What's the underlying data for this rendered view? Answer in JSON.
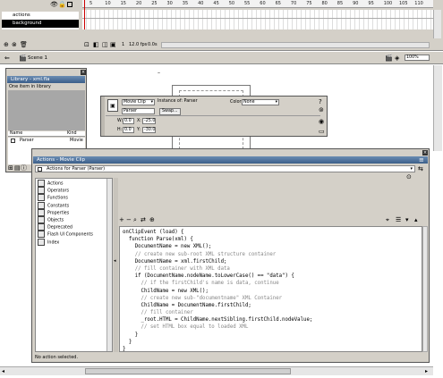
{
  "timeline": {
    "layers": [
      {
        "name": "actions"
      },
      {
        "name": "background"
      }
    ],
    "ruler_ticks": [
      "5",
      "10",
      "15",
      "20",
      "25",
      "30",
      "35",
      "40",
      "45",
      "50",
      "55",
      "60",
      "65",
      "70",
      "75",
      "80",
      "85",
      "90",
      "95",
      "100",
      "105",
      "110"
    ],
    "status": {
      "frame": "1",
      "fps": "12.0 fps",
      "elapsed": "0.0s"
    }
  },
  "edit_bar": {
    "scene": "Scene 1",
    "zoom": "100%"
  },
  "library": {
    "title": "Library - xml.fla",
    "count": "One item in library",
    "columns": {
      "name": "Name",
      "kind": "Kind"
    },
    "items": [
      {
        "name": "Parser",
        "kind": "Movie"
      }
    ]
  },
  "properties": {
    "symbol_type": "Movie Clip",
    "instance_of_label": "Instance of:",
    "instance_of": "Parser",
    "instance_name": "Parser",
    "swap_label": "Swap...",
    "color_label": "Color:",
    "color_value": "None",
    "w_label": "W:",
    "w_value": "0.0",
    "h_label": "H:",
    "h_value": "0.0",
    "x_label": "X:",
    "x_value": "-25.0",
    "y_label": "Y:",
    "y_value": "-30.0"
  },
  "actions": {
    "title": "Actions - Movie Clip",
    "target": "Actions for Parser (Parser)",
    "categories": [
      "Actions",
      "Operators",
      "Functions",
      "Constants",
      "Properties",
      "Objects",
      "Deprecated",
      "Flash UI Components",
      "Index"
    ],
    "code": [
      {
        "t": "onClipEvent (load) {",
        "c": false
      },
      {
        "t": "  function Parse(xml) {",
        "c": false
      },
      {
        "t": "    DocumentName = new XML();",
        "c": false
      },
      {
        "t": "    // create new sub-root XML structure container",
        "c": true
      },
      {
        "t": "    DocumentName = xml.firstChild;",
        "c": false
      },
      {
        "t": "    // fill container with XML data",
        "c": true
      },
      {
        "t": "    if (DocumentName.nodeName.toLowerCase() == \"data\") {",
        "c": false
      },
      {
        "t": "      // if the firstChild's name is data, continue",
        "c": true
      },
      {
        "t": "      ChildName = new XML();",
        "c": false
      },
      {
        "t": "      // create new sub-\"documentname\" XML Container",
        "c": true
      },
      {
        "t": "      ChildName = DocumentName.firstChild;",
        "c": false
      },
      {
        "t": "      // fill container",
        "c": true
      },
      {
        "t": "      _root.HTML = ChildName.nextSibling.firstChild.nodeValue;",
        "c": false
      },
      {
        "t": "      // set HTML box equal to loaded XML",
        "c": true
      },
      {
        "t": "    }",
        "c": false
      },
      {
        "t": "  }",
        "c": false
      },
      {
        "t": "}",
        "c": false
      }
    ],
    "status": "No action selected."
  }
}
